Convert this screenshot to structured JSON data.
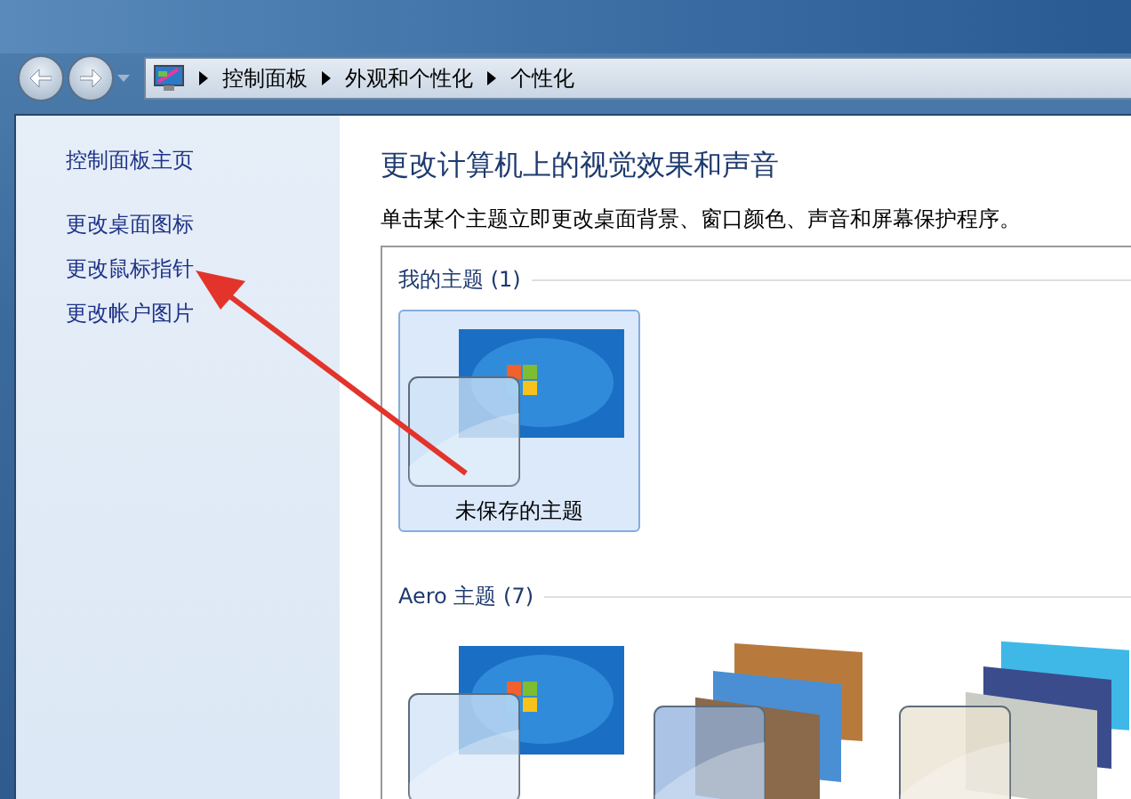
{
  "address_bar": {
    "crumbs": [
      "控制面板",
      "外观和个性化",
      "个性化"
    ]
  },
  "sidebar": {
    "home": "控制面板主页",
    "links": [
      "更改桌面图标",
      "更改鼠标指针",
      "更改帐户图片"
    ]
  },
  "content": {
    "title": "更改计算机上的视觉效果和声音",
    "subtitle": "单击某个主题立即更改桌面背景、窗口颜色、声音和屏幕保护程序。",
    "groups": [
      {
        "title": "我的主题 (1)",
        "themes": [
          {
            "label": "未保存的主题",
            "kind": "windows",
            "selected": true
          }
        ]
      },
      {
        "title": "Aero 主题 (7)",
        "themes": [
          {
            "kind": "windows",
            "selected": false
          },
          {
            "kind": "architecture",
            "selected": false
          },
          {
            "kind": "characters",
            "selected": false
          }
        ]
      }
    ]
  }
}
